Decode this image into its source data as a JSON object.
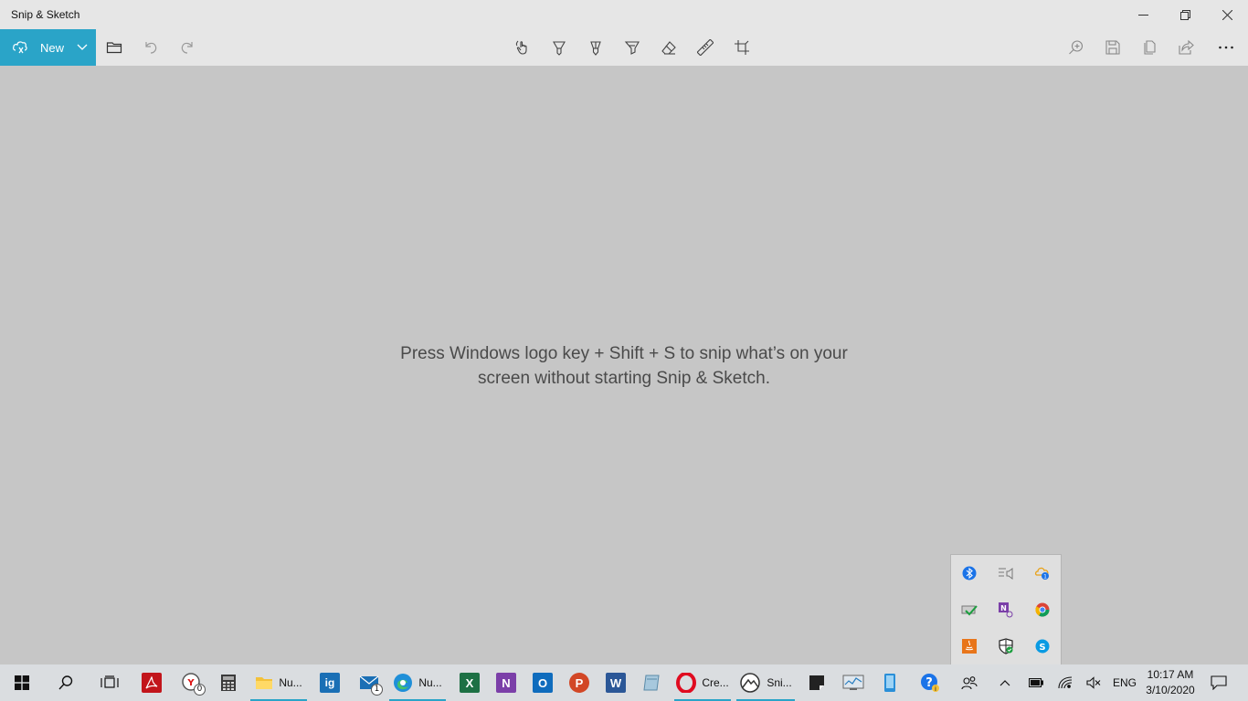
{
  "window": {
    "title": "Snip & Sketch"
  },
  "toolbar": {
    "new_label": "New",
    "icons": [
      "new-snip-icon",
      "chevron-down-icon",
      "open-file-icon",
      "undo-icon",
      "redo-icon",
      "touch-writing-icon",
      "ballpoint-pen-icon",
      "pencil-icon",
      "highlighter-icon",
      "eraser-icon",
      "ruler-icon",
      "crop-icon",
      "zoom-icon",
      "save-icon",
      "copy-icon",
      "share-icon",
      "more-icon"
    ]
  },
  "canvas": {
    "hint_line1": "Press Windows logo key + Shift + S to snip what’s on your",
    "hint_line2": "screen without starting Snip & Sketch."
  },
  "tray_flyout": {
    "icons": [
      "bluetooth-icon",
      "audio-settings-icon",
      "onedrive-sync-icon",
      "update-check-icon",
      "onenote-clipper-icon",
      "chrome-icon",
      "java-icon",
      "windows-security-icon",
      "skype-icon"
    ]
  },
  "taskbar": {
    "apps": [
      {
        "name": "file-explorer",
        "label": "Nu..."
      },
      {
        "name": "edge",
        "label": "Nu..."
      },
      {
        "name": "opera",
        "label": "Cre..."
      },
      {
        "name": "snip-sketch",
        "label": "Sni..."
      }
    ],
    "mail_badge": "1",
    "clock_badge": "0",
    "language": "ENG",
    "time": "10:17 AM",
    "date": "3/10/2020"
  },
  "colors": {
    "accent": "#2aa4c8",
    "canvas": "#c6c6c6",
    "chrome": "#e6e6e6",
    "taskbar": "#dadde0"
  }
}
